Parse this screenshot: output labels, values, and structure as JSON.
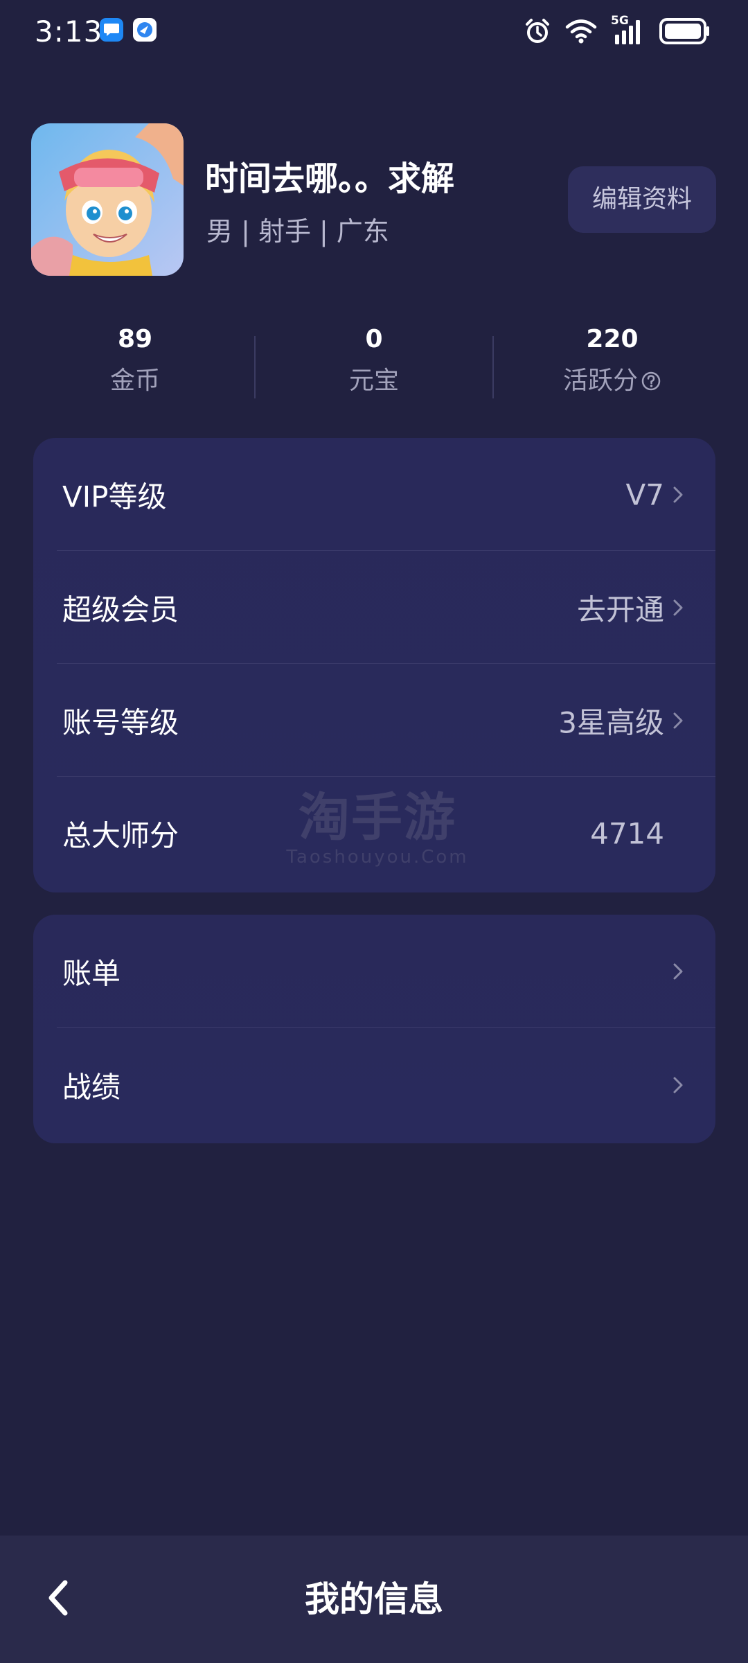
{
  "status_bar": {
    "time": "3:13",
    "network": "5G",
    "icons": [
      "message-app-icon",
      "browser-app-icon",
      "alarm-icon",
      "wifi-icon",
      "signal-icon",
      "battery-icon"
    ]
  },
  "profile": {
    "name": "时间去哪。。求解",
    "meta": "男 | 射手 | 广东",
    "edit_label": "编辑资料"
  },
  "stats": [
    {
      "value": "89",
      "label": "金币"
    },
    {
      "value": "0",
      "label": "元宝"
    },
    {
      "value": "220",
      "label": "活跃分"
    }
  ],
  "primary_card": {
    "rows": [
      {
        "label": "VIP等级",
        "value": "V7",
        "chevron": true
      },
      {
        "label": "超级会员",
        "value": "去开通",
        "chevron": true
      },
      {
        "label": "账号等级",
        "value": "3星高级",
        "chevron": true
      },
      {
        "label": "总大师分",
        "value": "4714",
        "chevron": false
      }
    ]
  },
  "secondary_card": {
    "rows": [
      {
        "label": "账单",
        "chevron": true
      },
      {
        "label": "战绩",
        "chevron": true
      }
    ]
  },
  "watermark": {
    "main": "淘手游",
    "sub": "Taoshouyou.Com"
  },
  "bottom_bar": {
    "title": "我的信息"
  },
  "colors": {
    "background": "#212140",
    "card": "#29295a",
    "edit_button": "#2e2e5c",
    "bottom_bar": "#2a2a4b",
    "muted_text": "#a2a2bb"
  }
}
